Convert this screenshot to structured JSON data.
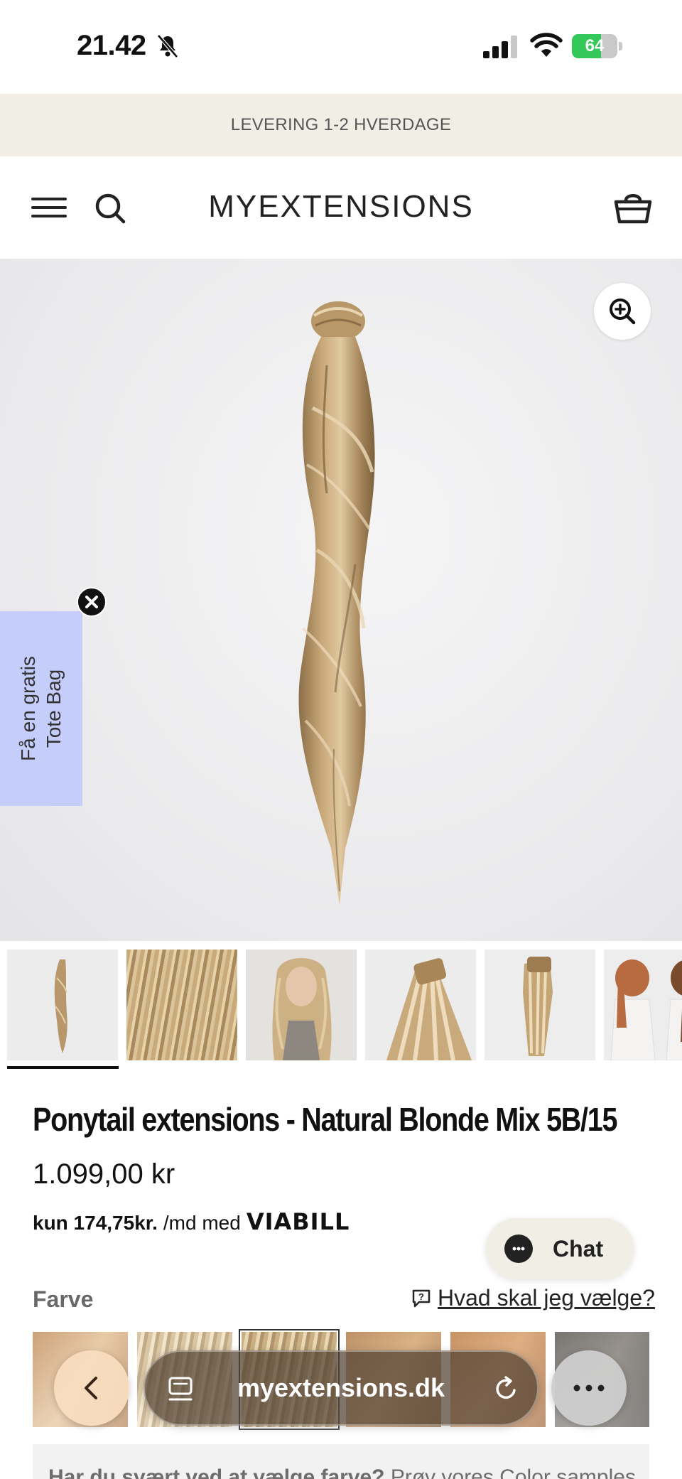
{
  "status_bar": {
    "time": "21.42",
    "battery": "64",
    "battery_level": 0.64
  },
  "announcement": {
    "text": "LEVERING 1-2 HVERDAGE"
  },
  "header": {
    "logo": "MYEXTENSIONS"
  },
  "promo": {
    "text_line1": "Få en gratis",
    "text_line2": "Tote Bag"
  },
  "thumbnails": [
    {
      "name": "ponytail-overview",
      "selected": true
    },
    {
      "name": "hair-texture-closeup"
    },
    {
      "name": "model-portrait"
    },
    {
      "name": "ponytail-clip-detail"
    },
    {
      "name": "ponytail-wrap-view"
    },
    {
      "name": "models-back-view"
    }
  ],
  "product": {
    "title": "Ponytail extensions - Natural Blonde Mix 5B/15",
    "price": "1.099,00 kr",
    "installment_amount": "kun 174,75kr.",
    "installment_suffix": "/md med",
    "installment_provider": "VIABILL"
  },
  "chat": {
    "label": "Chat"
  },
  "color_section": {
    "label": "Farve",
    "help_link": "Hvad skal jeg vælge?"
  },
  "help_box": {
    "bold": "Har du svært ved at vælge farve?",
    "text": " Prøv vores Color samples"
  },
  "browser": {
    "url": "myextensions.dk"
  },
  "colors": {
    "announcement_bg": "#f1eee6",
    "promo_bg": "#c5cdfa",
    "battery_green": "#34c759"
  }
}
